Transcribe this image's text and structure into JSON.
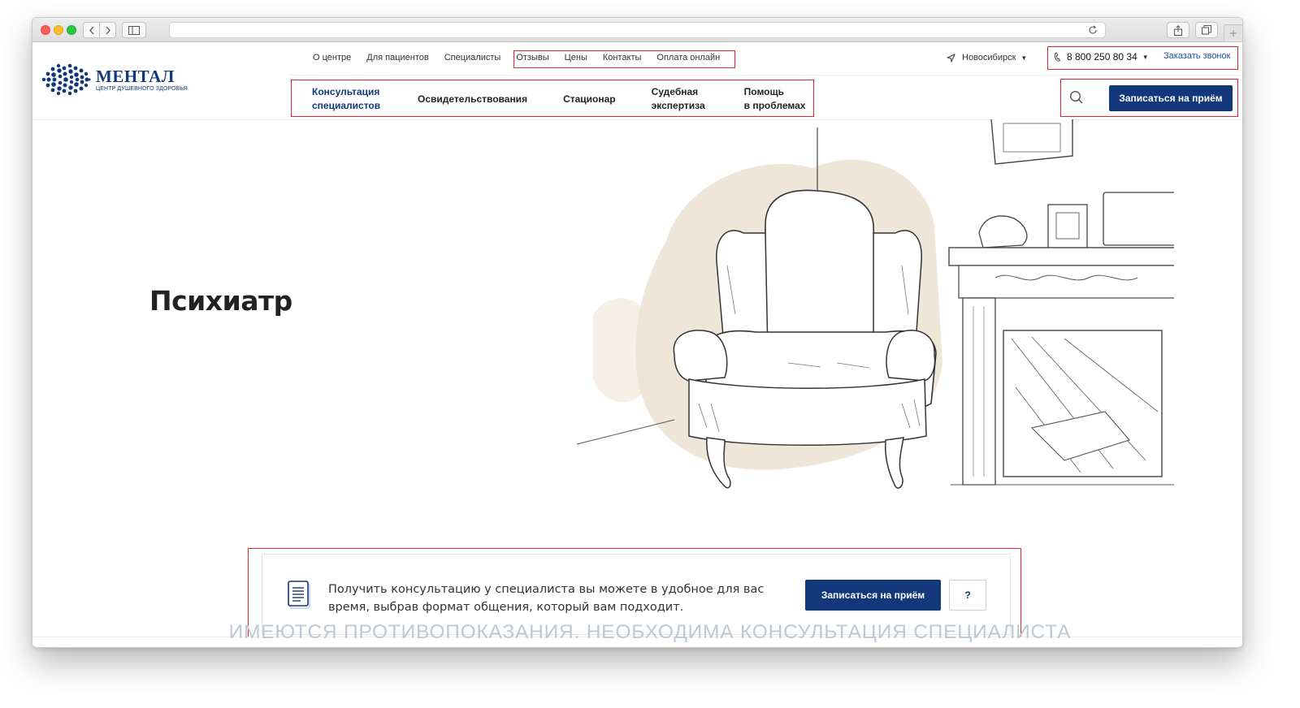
{
  "header": {
    "logo": {
      "title": "МЕНТАЛ",
      "subtitle": "ЦЕНТР ДУШЕВНОГО ЗДОРОВЬЯ"
    },
    "top_nav": [
      {
        "label": "О центре"
      },
      {
        "label": "Для пациентов"
      },
      {
        "label": "Специалисты"
      },
      {
        "label": "Отзывы"
      },
      {
        "label": "Цены"
      },
      {
        "label": "Контакты"
      },
      {
        "label": "Оплата онлайн"
      }
    ],
    "city": "Новосибирск",
    "phone": "8 800 250 80 34",
    "callback_label": "Заказать звонок",
    "main_nav": [
      {
        "line1": "Консультация",
        "line2": "специалистов"
      },
      {
        "line1": "Освидетельствования",
        "line2": ""
      },
      {
        "line1": "Стационар",
        "line2": ""
      },
      {
        "line1": "Судебная",
        "line2": "экспертиза"
      },
      {
        "line1": "Помощь",
        "line2": "в проблемах"
      }
    ],
    "book_button": "Записаться на приём"
  },
  "hero": {
    "title": "Психиатр"
  },
  "card": {
    "text": "Получить консультацию у специалиста вы можете в удобное для вас время, выбрав формат общения, который вам подходит.",
    "book_button": "Записаться на приём",
    "help_button": "?"
  },
  "disclaimer": "ИМЕЮТСЯ ПРОТИВОПОКАЗАНИЯ. НЕОБХОДИМА КОНСУЛЬТАЦИЯ СПЕЦИАЛИСТА",
  "colors": {
    "brand": "#12387b",
    "annotation": "#e0262b",
    "disclaimer": "#bdc8d2"
  }
}
